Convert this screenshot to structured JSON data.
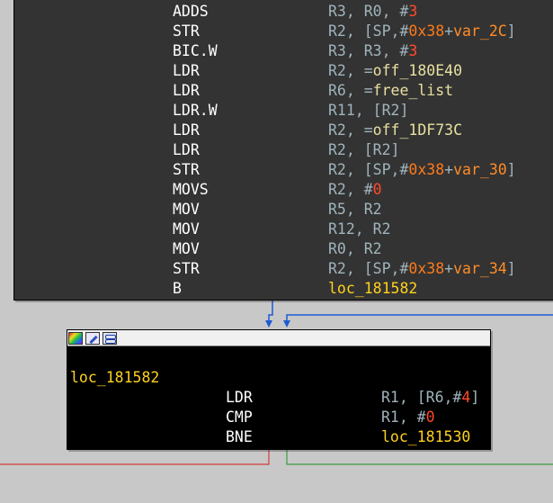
{
  "top_block": {
    "lines": [
      {
        "mnemonic": "ADDS",
        "operands": [
          {
            "t": "R3, R0, #",
            "c": "reg"
          },
          {
            "t": "3",
            "c": "num"
          }
        ]
      },
      {
        "mnemonic": "STR",
        "operands": [
          {
            "t": "R2, [SP,#",
            "c": "reg"
          },
          {
            "t": "0x38",
            "c": "hex"
          },
          {
            "t": "+",
            "c": "pun"
          },
          {
            "t": "var_2C",
            "c": "var"
          },
          {
            "t": "]",
            "c": "pun"
          }
        ]
      },
      {
        "mnemonic": "BIC.W",
        "operands": [
          {
            "t": "R3, R3, #",
            "c": "reg"
          },
          {
            "t": "3",
            "c": "num"
          }
        ]
      },
      {
        "mnemonic": "LDR",
        "operands": [
          {
            "t": "R2, =",
            "c": "reg"
          },
          {
            "t": "off_180E40",
            "c": "sym"
          }
        ]
      },
      {
        "mnemonic": "LDR",
        "operands": [
          {
            "t": "R6, =",
            "c": "reg"
          },
          {
            "t": "free_list",
            "c": "sym"
          }
        ]
      },
      {
        "mnemonic": "LDR.W",
        "operands": [
          {
            "t": "R11, [R2]",
            "c": "reg"
          }
        ]
      },
      {
        "mnemonic": "LDR",
        "operands": [
          {
            "t": "R2, =",
            "c": "reg"
          },
          {
            "t": "off_1DF73C",
            "c": "sym"
          }
        ]
      },
      {
        "mnemonic": "LDR",
        "operands": [
          {
            "t": "R2, [R2]",
            "c": "reg"
          }
        ]
      },
      {
        "mnemonic": "STR",
        "operands": [
          {
            "t": "R2, [SP,#",
            "c": "reg"
          },
          {
            "t": "0x38",
            "c": "hex"
          },
          {
            "t": "+",
            "c": "pun"
          },
          {
            "t": "var_30",
            "c": "var"
          },
          {
            "t": "]",
            "c": "pun"
          }
        ]
      },
      {
        "mnemonic": "MOVS",
        "operands": [
          {
            "t": "R2, #",
            "c": "reg"
          },
          {
            "t": "0",
            "c": "num"
          }
        ]
      },
      {
        "mnemonic": "MOV",
        "operands": [
          {
            "t": "R5, R2",
            "c": "reg"
          }
        ]
      },
      {
        "mnemonic": "MOV",
        "operands": [
          {
            "t": "R12, R2",
            "c": "reg"
          }
        ]
      },
      {
        "mnemonic": "MOV",
        "operands": [
          {
            "t": "R0, R2",
            "c": "reg"
          }
        ]
      },
      {
        "mnemonic": "STR",
        "operands": [
          {
            "t": "R2, [SP,#",
            "c": "reg"
          },
          {
            "t": "0x38",
            "c": "hex"
          },
          {
            "t": "+",
            "c": "pun"
          },
          {
            "t": "var_34",
            "c": "var"
          },
          {
            "t": "]",
            "c": "pun"
          }
        ]
      },
      {
        "mnemonic": "B",
        "operands": [
          {
            "t": "loc_181582",
            "c": "loc"
          }
        ]
      }
    ]
  },
  "bottom_block": {
    "titlebar_icons": [
      "color-palette-icon",
      "edit-node-icon",
      "graph-view-icon"
    ],
    "label": "loc_181582",
    "lines": [
      {
        "mnemonic": "LDR",
        "operands": [
          {
            "t": "R1, [R6,#",
            "c": "reg"
          },
          {
            "t": "4",
            "c": "num"
          },
          {
            "t": "]",
            "c": "pun"
          }
        ]
      },
      {
        "mnemonic": "CMP",
        "operands": [
          {
            "t": "R1, #",
            "c": "reg"
          },
          {
            "t": "0",
            "c": "num"
          }
        ]
      },
      {
        "mnemonic": "BNE",
        "operands": [
          {
            "t": "loc_181530",
            "c": "loc"
          }
        ]
      }
    ]
  },
  "colors": {
    "background": "#c8c8c8",
    "edge_unconditional": "#1e5ad2",
    "edge_false": "#d23c3c",
    "edge_true": "#3c9c3c"
  }
}
